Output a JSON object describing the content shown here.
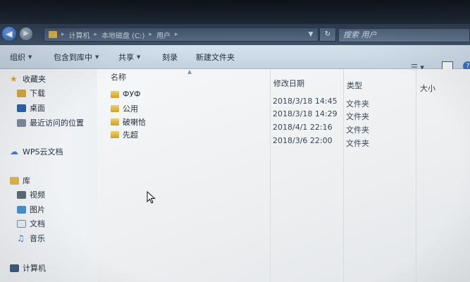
{
  "address": {
    "segments": [
      "计算机",
      "本地磁盘 (C:)",
      "用户"
    ],
    "search_placeholder": "搜索 用户"
  },
  "toolbar": {
    "organize": "组织",
    "include_in_library": "包含到库中",
    "share": "共享",
    "burn": "刻录",
    "new_folder": "新建文件夹"
  },
  "nav": {
    "favorites": "收藏夹",
    "downloads": "下载",
    "desktop": "桌面",
    "recent": "最近访问的位置",
    "wps_cloud": "WPS云文档",
    "libraries": "库",
    "videos": "视频",
    "pictures": "图片",
    "documents": "文档",
    "music": "音乐",
    "computer": "计算机"
  },
  "columns": {
    "name": "名称",
    "modified": "修改日期",
    "type": "类型",
    "size": "大小"
  },
  "files": [
    {
      "name": "ФУФ",
      "modified": "2018/3/18 14:45",
      "type": "文件夹"
    },
    {
      "name": "公用",
      "modified": "2018/3/18 14:29",
      "type": "文件夹"
    },
    {
      "name": "破喇恰",
      "modified": "2018/4/1 22:16",
      "type": "文件夹"
    },
    {
      "name": "先超",
      "modified": "2018/3/6 22:00",
      "type": "文件夹"
    }
  ],
  "colors": {
    "toolbar": "#c9d7e5",
    "folder": "#e0b44e",
    "accent": "#2b5da8"
  }
}
